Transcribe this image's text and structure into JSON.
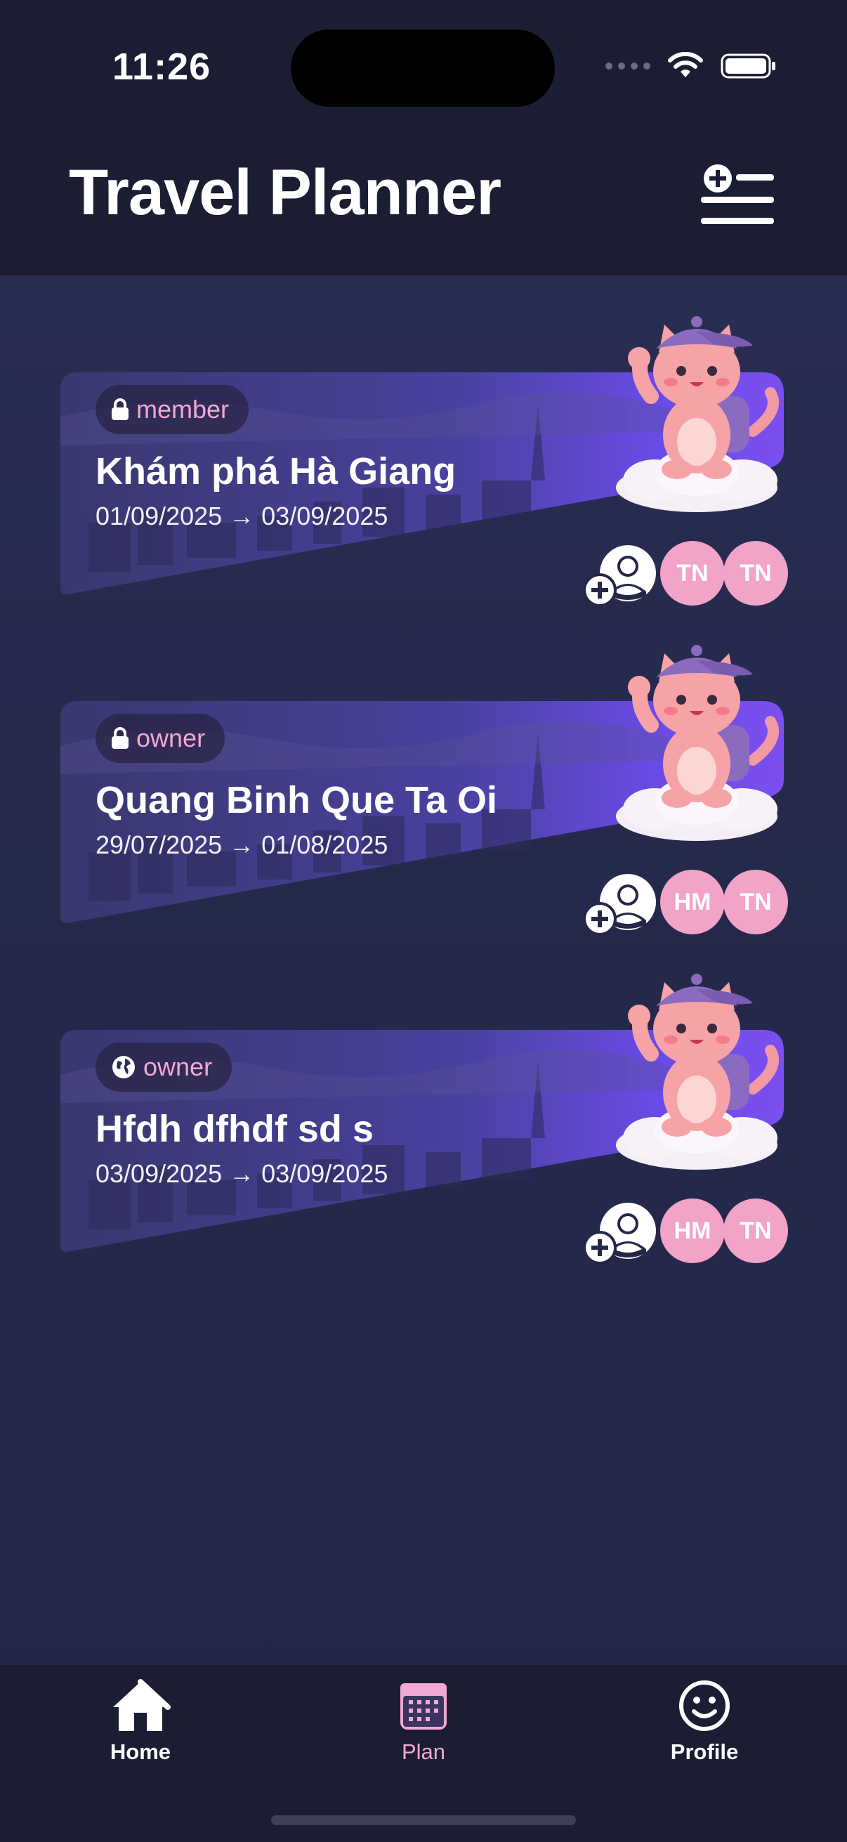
{
  "status_bar": {
    "time": "11:26"
  },
  "header": {
    "title": "Travel Planner",
    "action_icon": "add-list-icon"
  },
  "trips": [
    {
      "visibility": "member",
      "visibility_icon": "lock-icon",
      "name": "Khám phá Hà Giang",
      "dates": "01/09/2025 → 03/09/2025",
      "members": [
        "TN",
        "TN"
      ]
    },
    {
      "visibility": "owner",
      "visibility_icon": "lock-icon",
      "name": "Quang Binh Que Ta Oi",
      "dates": "29/07/2025 → 01/08/2025",
      "members": [
        "HM",
        "TN"
      ]
    },
    {
      "visibility": "owner",
      "visibility_icon": "globe-icon",
      "name": "Hfdh dfhdf sd s",
      "dates": "03/09/2025 → 03/09/2025",
      "members": [
        "HM",
        "TN"
      ]
    }
  ],
  "bottom_nav": {
    "items": [
      {
        "label": "Home",
        "icon": "home-icon",
        "active": false
      },
      {
        "label": "Plan",
        "icon": "calendar-icon",
        "active": true
      },
      {
        "label": "Profile",
        "icon": "smiley-icon",
        "active": false
      }
    ]
  },
  "colors": {
    "background": "#242848",
    "bar": "#1b1d33",
    "accent_pink": "#f2a9d1",
    "card_purple": "#7b4ff0",
    "avatar_pink": "#f1a3c8"
  }
}
